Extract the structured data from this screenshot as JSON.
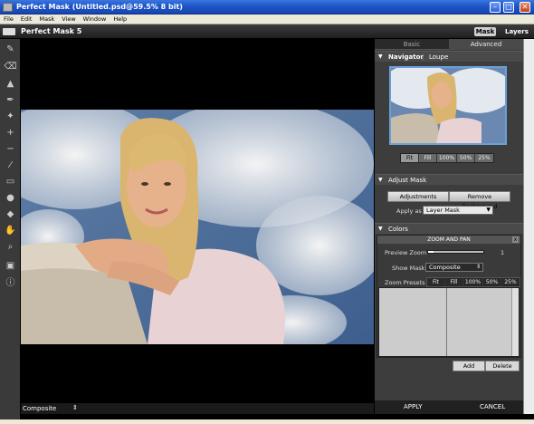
{
  "window": {
    "title": "Perfect Mask (Untitled.psd@59.5% 8 bit)"
  },
  "menu": [
    "File",
    "Edit",
    "Mask",
    "View",
    "Window",
    "Help"
  ],
  "app": {
    "name": "Perfect Mask 5",
    "tab_mask": "Mask",
    "tab_layers": "Layers"
  },
  "toolbar": {
    "tools": [
      "brush-icon",
      "eraser-icon",
      "bucket-fill-icon",
      "pen-icon",
      "magic-brush-icon",
      "keep-dropper-icon",
      "drop-dropper-icon",
      "eyedropper-icon",
      "chisel-icon",
      "blur-icon",
      "paint-bucket-icon",
      "hand-icon",
      "zoom-icon",
      "view-mode-icon",
      "info-icon"
    ]
  },
  "canvas": {
    "status_value": "Composite"
  },
  "panel": {
    "tabs": [
      "Basic",
      "Advanced"
    ],
    "navigator": {
      "title": "Navigator",
      "loupe": "Loupe",
      "zoom_buttons": [
        "Fit",
        "Fill",
        "100%",
        "50%",
        "25%"
      ],
      "active": "Fit"
    },
    "adjust": {
      "title": "Adjust Mask",
      "adjustments_label": "Adjustments",
      "remove_bg_label": "Remove Background",
      "apply_as_label": "Apply as",
      "apply_as_value": "Layer Mask"
    },
    "colors": {
      "title": "Colors"
    },
    "zoom_pan": {
      "title": "ZOOM AND PAN",
      "close": "x",
      "preview_zoom_label": "Preview Zoom",
      "preview_zoom_fraction": 0.1,
      "slider_end": "1",
      "show_mask_label": "Show Mask",
      "show_mask_value": "Composite",
      "zoom_presets_label": "Zoom Presets",
      "preset_buttons": [
        "Fit",
        "Fill",
        "100%",
        "50%",
        "25%"
      ]
    },
    "add_label": "Add",
    "delete_label": "Delete",
    "apply_label": "APPLY",
    "cancel_label": "CANCEL"
  }
}
